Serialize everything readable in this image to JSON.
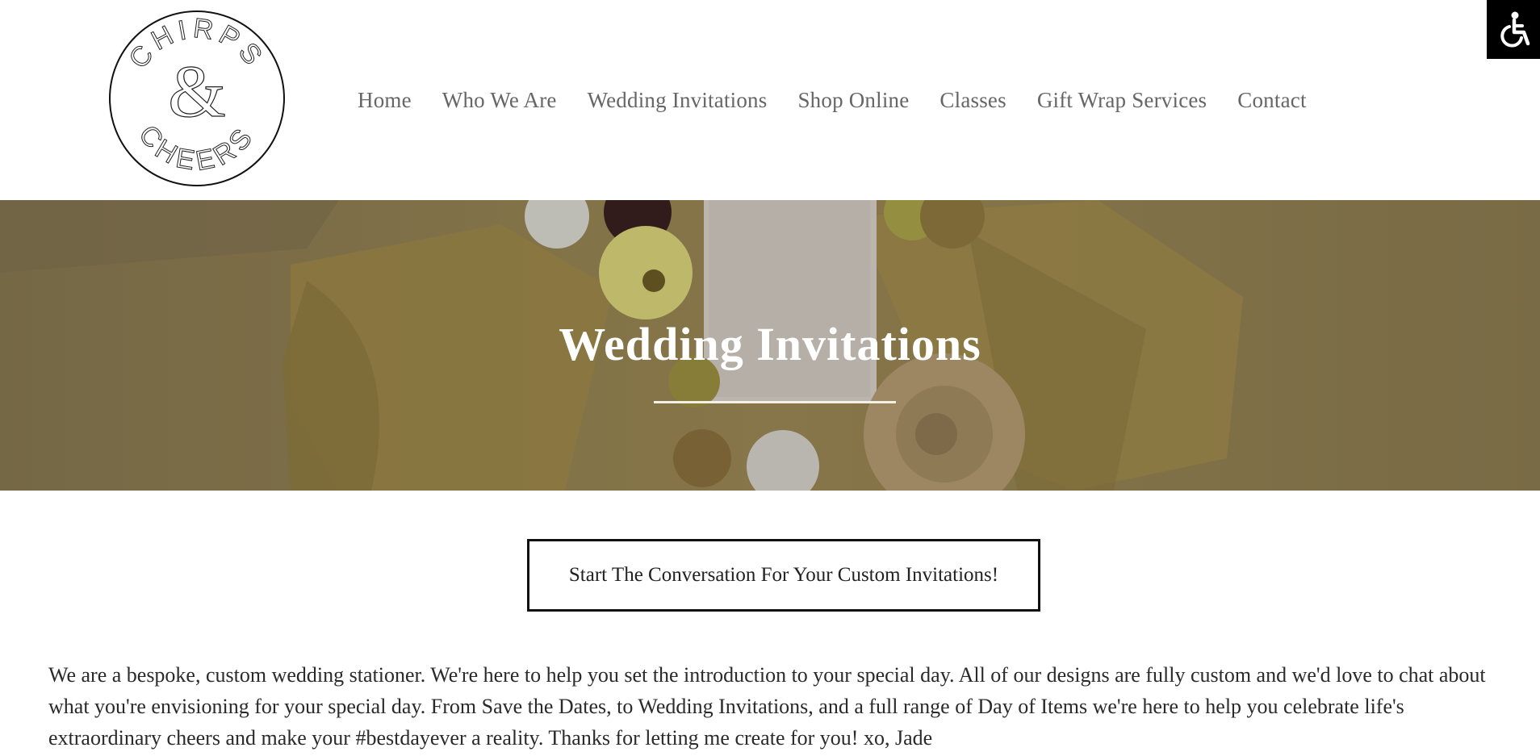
{
  "logo": {
    "top_text": "CHIRPS",
    "ampersand": "&",
    "bottom_text": "CHEERS"
  },
  "nav": {
    "items": [
      {
        "label": "Home"
      },
      {
        "label": "Who We Are"
      },
      {
        "label": "Wedding Invitations"
      },
      {
        "label": "Shop Online"
      },
      {
        "label": "Classes"
      },
      {
        "label": "Gift Wrap Services"
      },
      {
        "label": "Contact"
      }
    ]
  },
  "accessibility": {
    "icon": "wheelchair-icon"
  },
  "hero": {
    "title": "Wedding Invitations"
  },
  "cta": {
    "label": "Start The Conversation For Your Custom Invitations!"
  },
  "intro": {
    "text": "We are a bespoke, custom wedding stationer.  We're here to help you set the introduction to your special day. All of our designs are fully custom and we'd love to chat about what you're envisioning for your special day.  From Save the Dates, to Wedding Invitations, and a full range of Day of Items we're here to help you celebrate life's extraordinary cheers and make your #bestdayever a reality. Thanks for letting me create for you! xo, Jade"
  },
  "colors": {
    "accent": "#000000",
    "hero_overlay": "#8a7a52",
    "nav_text": "#666666"
  }
}
